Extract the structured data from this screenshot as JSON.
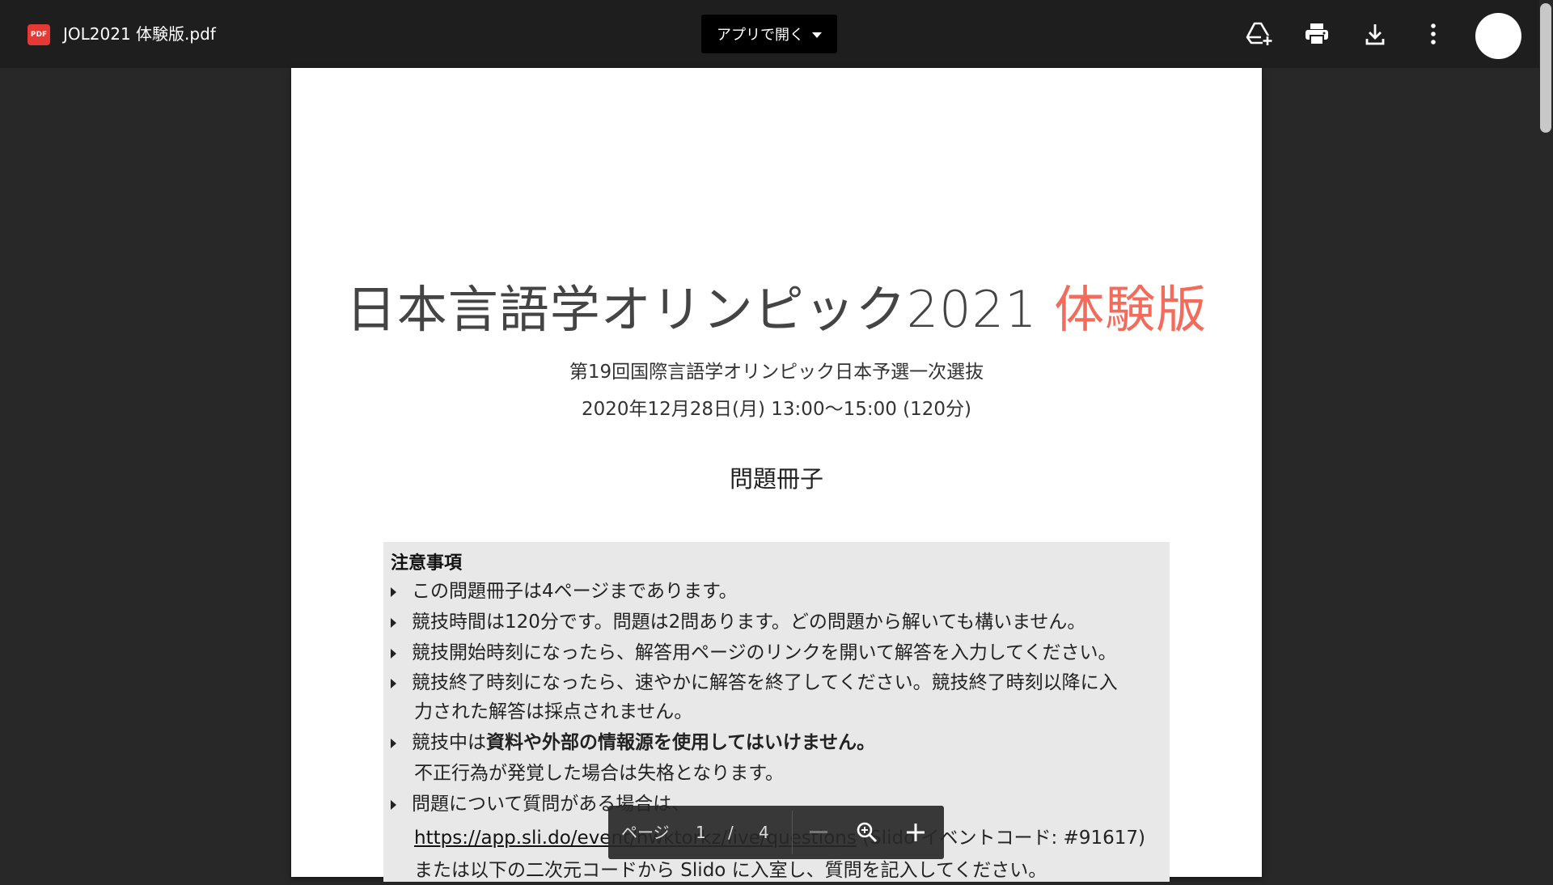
{
  "header": {
    "file_badge": "PDF",
    "file_name": "JOL2021 体験版.pdf",
    "open_with_label": "アプリで開く"
  },
  "icons": [
    "add-to-drive-icon",
    "print-icon",
    "download-icon",
    "more-vert-icon",
    "avatar"
  ],
  "document": {
    "title_main": "日本言語学オリンピック2021 ",
    "title_accent": "体験版",
    "subtitle_1": "第19回国際言語学オリンピック日本予選一次選抜",
    "subtitle_2": "2020年12月28日(月) 13:00〜15:00 (120分)",
    "booklet_label": "問題冊子",
    "notice": {
      "heading": "注意事項",
      "items": [
        "この問題冊子は4ページまであります。",
        "競技時間は120分です。問題は2問あります。どの問題から解いても構いません。",
        "競技開始時刻になったら、解答用ページのリンクを開いて解答を入力してください。",
        "競技終了時刻になったら、速やかに解答を終了してください。競技終了時刻以降に入",
        "競技中は",
        "問題について質問がある場合は、"
      ],
      "item4_cont": "力された解答は採点されません。",
      "item5_bold": "資料や外部の情報源を使用してはいけません。",
      "item5_cont": "不正行為が発覚した場合は失格となります。",
      "item6_link": "https://app.sli.do/event/nwktorkz/live/questions",
      "item6_after": " (Slido イベントコード: #91617)",
      "item6_cont2": "または以下の二次元コードから Slido に入室し、質問を記入してください。"
    }
  },
  "page_toolbar": {
    "page_label": "ページ",
    "current_page": "1",
    "separator": "/",
    "total_pages": "4"
  },
  "colors": {
    "accent": "#f26b5b",
    "topbar": "#1e1e1e",
    "viewer_bg": "#282828",
    "notice_bg": "#e8e8e8"
  }
}
